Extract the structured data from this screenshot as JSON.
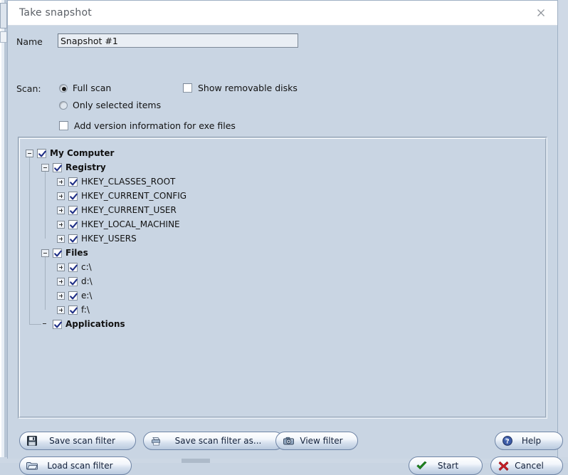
{
  "window": {
    "title": "Take snapshot",
    "close_icon": "close-icon"
  },
  "form": {
    "name_label": "Name",
    "name_value": "Snapshot #1",
    "scan_label": "Scan:",
    "options": {
      "full_scan": "Full scan",
      "only_selected": "Only selected items",
      "show_removable": "Show removable disks",
      "add_version": "Add version information for exe files"
    },
    "states": {
      "full_scan_selected": true,
      "only_selected_selected": false,
      "show_removable_checked": false,
      "add_version_checked": false
    }
  },
  "tree": {
    "nodes": [
      {
        "label": "My Computer",
        "depth": 0,
        "expander": "minus",
        "checked": true,
        "bold": true
      },
      {
        "label": "Registry",
        "depth": 1,
        "expander": "minus",
        "checked": true,
        "bold": true
      },
      {
        "label": "HKEY_CLASSES_ROOT",
        "depth": 2,
        "expander": "plus",
        "checked": true,
        "bold": false
      },
      {
        "label": "HKEY_CURRENT_CONFIG",
        "depth": 2,
        "expander": "plus",
        "checked": true,
        "bold": false
      },
      {
        "label": "HKEY_CURRENT_USER",
        "depth": 2,
        "expander": "plus",
        "checked": true,
        "bold": false
      },
      {
        "label": "HKEY_LOCAL_MACHINE",
        "depth": 2,
        "expander": "plus",
        "checked": true,
        "bold": false
      },
      {
        "label": "HKEY_USERS",
        "depth": 2,
        "expander": "plus",
        "checked": true,
        "bold": false
      },
      {
        "label": "Files",
        "depth": 1,
        "expander": "minus",
        "checked": true,
        "bold": true
      },
      {
        "label": "c:\\",
        "depth": 2,
        "expander": "plus",
        "checked": true,
        "bold": false
      },
      {
        "label": "d:\\",
        "depth": 2,
        "expander": "plus",
        "checked": true,
        "bold": false
      },
      {
        "label": "e:\\",
        "depth": 2,
        "expander": "plus",
        "checked": true,
        "bold": false
      },
      {
        "label": "f:\\",
        "depth": 2,
        "expander": "plus",
        "checked": true,
        "bold": false
      },
      {
        "label": "Applications",
        "depth": 1,
        "expander": "none",
        "checked": true,
        "bold": true
      }
    ]
  },
  "buttons": {
    "save_filter": {
      "label": "Save scan filter",
      "icon": "floppy-disk-icon"
    },
    "save_filter_as": {
      "label": "Save scan filter as...",
      "icon": "printer-icon"
    },
    "view_filter": {
      "label": "View filter",
      "icon": "camera-icon"
    },
    "load_filter": {
      "label": "Load scan filter",
      "icon": "folder-icon"
    },
    "help": {
      "label": "Help",
      "icon": "question-globe-icon"
    },
    "start": {
      "label": "Start",
      "icon": "green-check-icon"
    },
    "cancel": {
      "label": "Cancel",
      "icon": "red-cross-icon"
    }
  },
  "colors": {
    "dialog_bg": "#c9d5e3",
    "titlebar_bg": "#ffffff",
    "title_text": "#5a5f66",
    "check_navy": "#1f2f86",
    "start_green": "#1f8a20",
    "cancel_red": "#cc1f26",
    "help_blue": "#2f4f9e"
  }
}
